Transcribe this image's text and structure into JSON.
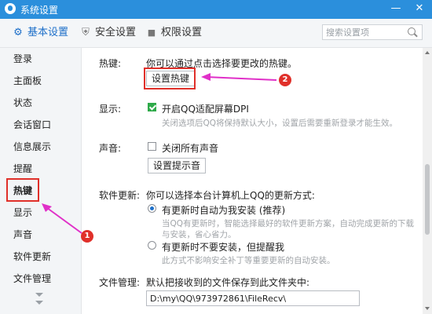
{
  "window": {
    "title": "系统设置",
    "minimize_glyph": "—",
    "close_glyph": "✕"
  },
  "tabs": [
    {
      "label": "基本设置",
      "icon": "gear-icon",
      "glyph": "⚙",
      "active": true
    },
    {
      "label": "安全设置",
      "icon": "shield-icon",
      "glyph": "⛨",
      "active": false
    },
    {
      "label": "权限设置",
      "icon": "lock-icon",
      "glyph": "🔒",
      "active": false
    }
  ],
  "search": {
    "placeholder": "搜索设置项",
    "icon": "search-icon"
  },
  "sidebar": {
    "items": [
      {
        "label": "登录"
      },
      {
        "label": "主面板"
      },
      {
        "label": "状态"
      },
      {
        "label": "会话窗口"
      },
      {
        "label": "信息展示"
      },
      {
        "label": "提醒"
      },
      {
        "label": "热键",
        "active": true
      },
      {
        "label": "显示"
      },
      {
        "label": "声音"
      },
      {
        "label": "软件更新"
      },
      {
        "label": "文件管理"
      }
    ]
  },
  "hotkey": {
    "label": "热键:",
    "desc": "你可以通过点击选择要更改的热键。",
    "button": "设置热键"
  },
  "display": {
    "label": "显示:",
    "checkbox_label": "开启QQ适配屏幕DPI",
    "checked": true,
    "hint": "关闭选项后QQ将保持默认大小，设置后需要重新登录才能生效。"
  },
  "sound": {
    "label": "声音:",
    "checkbox_label": "关闭所有声音",
    "checked": false,
    "button": "设置提示音"
  },
  "update": {
    "label": "软件更新:",
    "desc": "你可以选择本台计算机上QQ的更新方式:",
    "option1": {
      "label": "有更新时自动为我安装 (推荐)",
      "hint_line1": "当QQ有更新时，智能选择最好的软件更新方案，自动完成更新的下载",
      "hint_line2": "与安装，省心省力。",
      "selected": true
    },
    "option2": {
      "label": "有更新时不要安装，但提醒我",
      "hint": "此方式不影响安全补丁等重要更新的自动安装。",
      "selected": false
    }
  },
  "files": {
    "label": "文件管理:",
    "desc": "默认把接收到的文件保存到此文件夹中:",
    "path": "D:\\my\\QQ\\973972861\\FileRecv\\"
  },
  "annotations": {
    "marker1": "1",
    "marker2": "2",
    "color": "#e0302a",
    "arrow_color": "#e030c8"
  },
  "colors": {
    "title_bar": "#2b8fdc",
    "accent": "#1d6fc9",
    "check_green": "#2faa4a"
  }
}
